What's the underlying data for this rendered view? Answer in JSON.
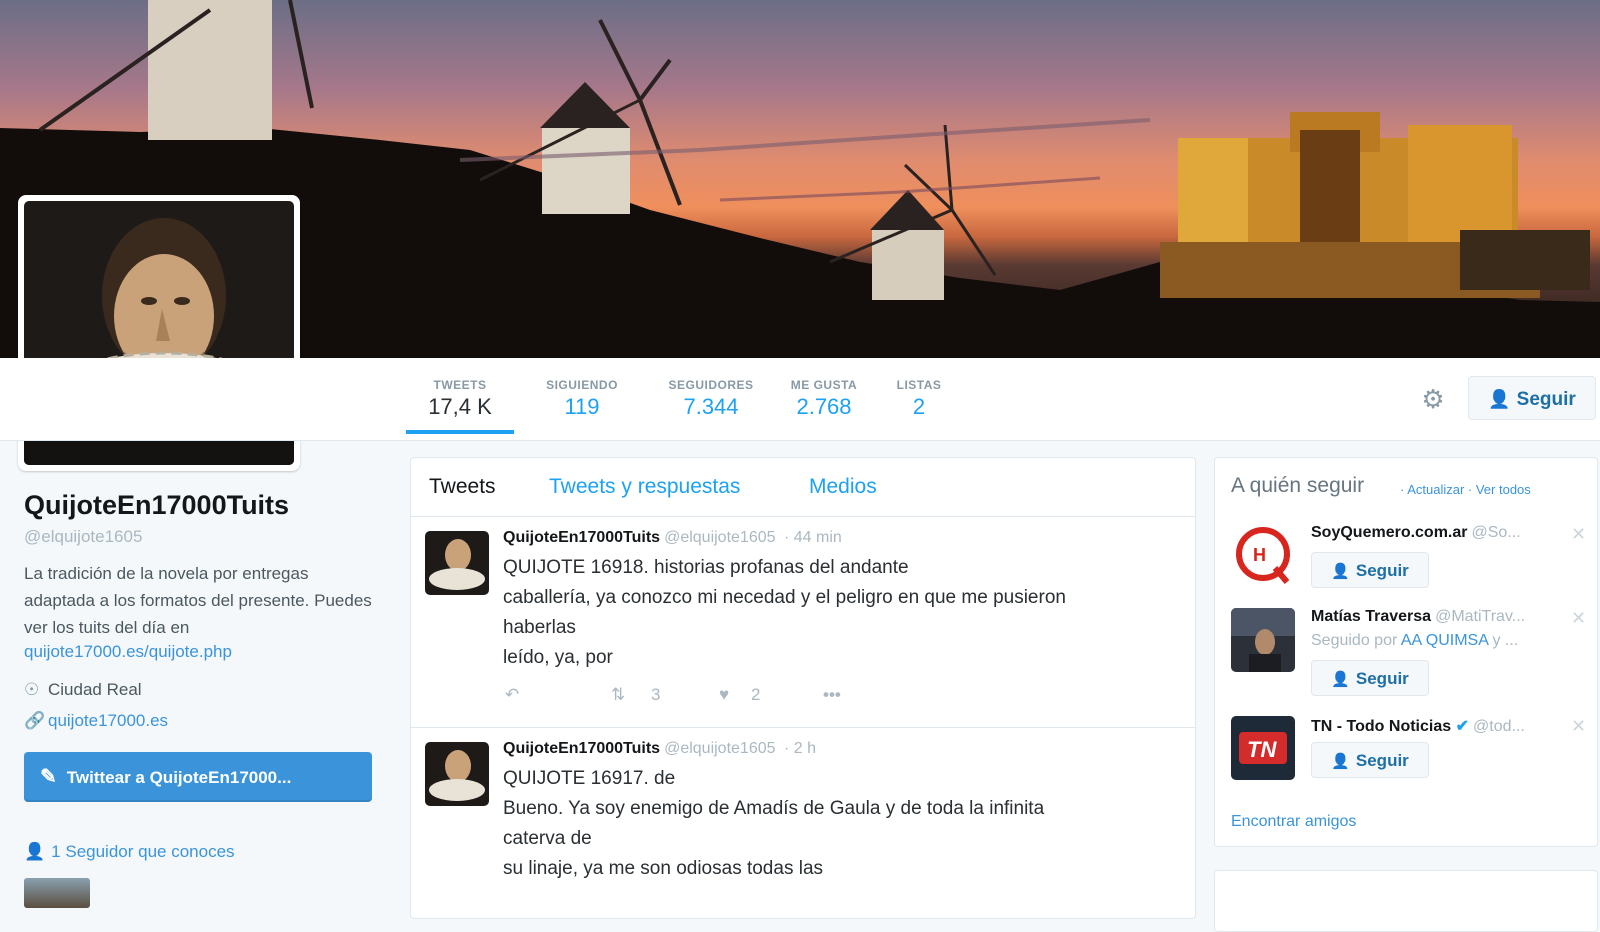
{
  "stats": [
    {
      "label": "TWEETS",
      "value": "17,4 K"
    },
    {
      "label": "SIGUIENDO",
      "value": "119"
    },
    {
      "label": "SEGUIDORES",
      "value": "7.344"
    },
    {
      "label": "ME GUSTA",
      "value": "2.768"
    },
    {
      "label": "LISTAS",
      "value": "2"
    }
  ],
  "header": {
    "gear_icon": "gear-icon",
    "follow_label": "Seguir",
    "follow_icon": "add-user-icon"
  },
  "profile": {
    "name": "QuijoteEn17000Tuits",
    "handle": "@elquijote1605",
    "bio": "La tradición de la novela por entregas adaptada a los formatos del presente. Puedes ver los tuits del día en",
    "bio_link": "quijote17000.es/quijote.php",
    "location": "Ciudad Real",
    "website": "quijote17000.es",
    "tweet_to_label": "Twittear a QuijoteEn17000...",
    "known_followers": "1 Seguidor que conoces"
  },
  "timeline": {
    "tabs": [
      "Tweets",
      "Tweets y respuestas",
      "Medios"
    ],
    "tweets": [
      {
        "name": "QuijoteEn17000Tuits",
        "handle": "@elquijote1605",
        "time": "· 44 min",
        "lines": [
          "QUIJOTE 16918. historias profanas del andante",
          "caballería, ya conozco mi necedad y el peligro en que me pusieron",
          "haberlas",
          "leído, ya, por"
        ],
        "retweets": "3",
        "likes": "2"
      },
      {
        "name": "QuijoteEn17000Tuits",
        "handle": "@elquijote1605",
        "time": "· 2 h",
        "lines": [
          "QUIJOTE 16917.  de",
          "Bueno. Ya soy enemigo de Amadís de Gaula y de toda la infinita",
          "caterva de",
          "su linaje, ya me son odiosas todas las"
        ]
      }
    ]
  },
  "who_to_follow": {
    "title": "A quién seguir",
    "refresh": "· Actualizar · Ver todos",
    "items": [
      {
        "name": "SoyQuemero.com.ar",
        "handle": "@So...",
        "sub": "",
        "sub_link": "",
        "button": "Seguir"
      },
      {
        "name": "Matías Traversa",
        "handle": "@MatiTrav...",
        "sub": "Seguido por",
        "sub_link": "AA QUIMSA",
        "sub_tail": "y ...",
        "button": "Seguir"
      },
      {
        "name": "TN - Todo Noticias",
        "handle": "@tod...",
        "sub": "",
        "sub_link": "",
        "button": "Seguir"
      }
    ],
    "find_friends": "Encontrar amigos"
  }
}
